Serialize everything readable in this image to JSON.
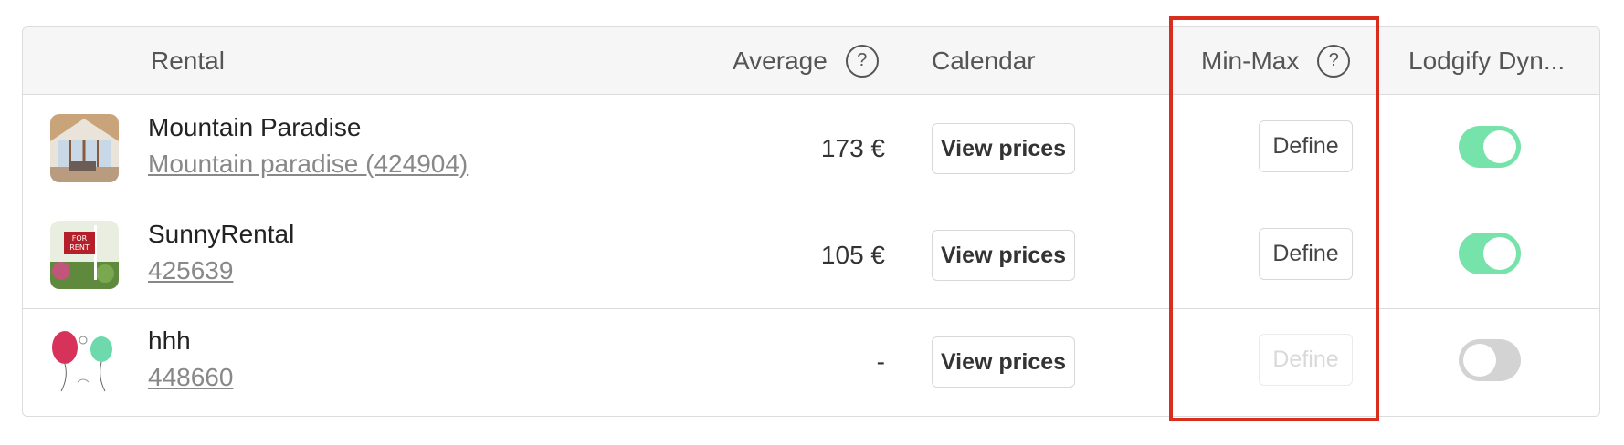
{
  "table": {
    "columns": {
      "rental": "Rental",
      "average": "Average",
      "calendar": "Calendar",
      "minmax": "Min-Max",
      "lodgify": "Lodgify Dyn..."
    },
    "help_glyph": "?",
    "rows": [
      {
        "title": "Mountain Paradise",
        "subtitle": "Mountain paradise (424904)",
        "average": "173 €",
        "view_prices": "View prices",
        "define": "Define",
        "define_enabled": true,
        "toggle_on": true,
        "thumb_icon": "cabin-thumbnail"
      },
      {
        "title": "SunnyRental",
        "subtitle": "425639",
        "average": "105 €",
        "view_prices": "View prices",
        "define": "Define",
        "define_enabled": true,
        "toggle_on": true,
        "thumb_icon": "for-rent-sign-thumbnail"
      },
      {
        "title": "hhh",
        "subtitle": "448660",
        "average": "-",
        "view_prices": "View prices",
        "define": "Define",
        "define_enabled": false,
        "toggle_on": false,
        "thumb_icon": "balloons-thumbnail"
      }
    ]
  },
  "colors": {
    "toggle_on": "#76e3ab",
    "toggle_off": "#d3d3d3",
    "highlight": "#d72e1d"
  }
}
